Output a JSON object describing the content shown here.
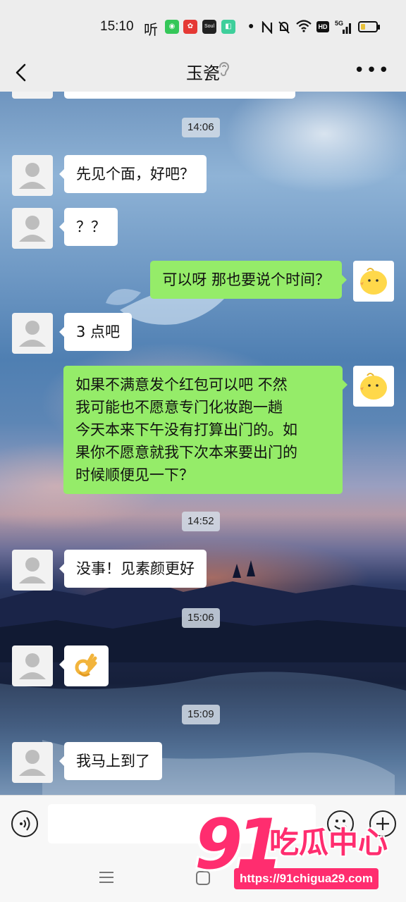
{
  "status_bar": {
    "time": "15:10",
    "listen_label": "听",
    "app_icons": [
      {
        "name": "green-app-icon",
        "color": "#35c759",
        "glyph": "◉"
      },
      {
        "name": "red-app-icon",
        "color": "#e53935",
        "glyph": "✿"
      },
      {
        "name": "soul-app-icon",
        "color": "#222222",
        "glyph": "Soul"
      },
      {
        "name": "teal-app-icon",
        "color": "#3ecf9b",
        "glyph": "◧"
      }
    ],
    "network_label": "5G",
    "hd_label": "HD",
    "battery_level": 0.3
  },
  "header": {
    "title": "玉瓷"
  },
  "messages": [
    {
      "type": "timestamp",
      "text": "14:06"
    },
    {
      "type": "incoming",
      "text": "先见个面，好吧？"
    },
    {
      "type": "incoming",
      "text": "？？"
    },
    {
      "type": "outgoing",
      "text": "可以呀  那也要说个时间？"
    },
    {
      "type": "incoming",
      "text": "3 点吧"
    },
    {
      "type": "outgoing",
      "lines": [
        "如果不满意发个红包可以吧  不然",
        "我可能也不愿意专门化妆跑一趟",
        "今天本来下午没有打算出门的。如",
        "果你不愿意就我下次本来要出门的",
        "时候顺便见一下？"
      ]
    },
    {
      "type": "timestamp",
      "text": "14:52"
    },
    {
      "type": "incoming",
      "text": "没事！见素颜更好"
    },
    {
      "type": "timestamp",
      "text": "15:06"
    },
    {
      "type": "incoming",
      "sticker": "ok-hand"
    },
    {
      "type": "timestamp",
      "text": "15:09"
    },
    {
      "type": "incoming",
      "text": "我马上到了"
    }
  ],
  "watermark": {
    "number": "91",
    "brand": "吃瓜中心",
    "url": "https://91chigua29.com"
  },
  "colors": {
    "outgoing_bubble": "#95ec69",
    "incoming_bubble": "#ffffff",
    "watermark_pink": "#ff2d6f"
  }
}
